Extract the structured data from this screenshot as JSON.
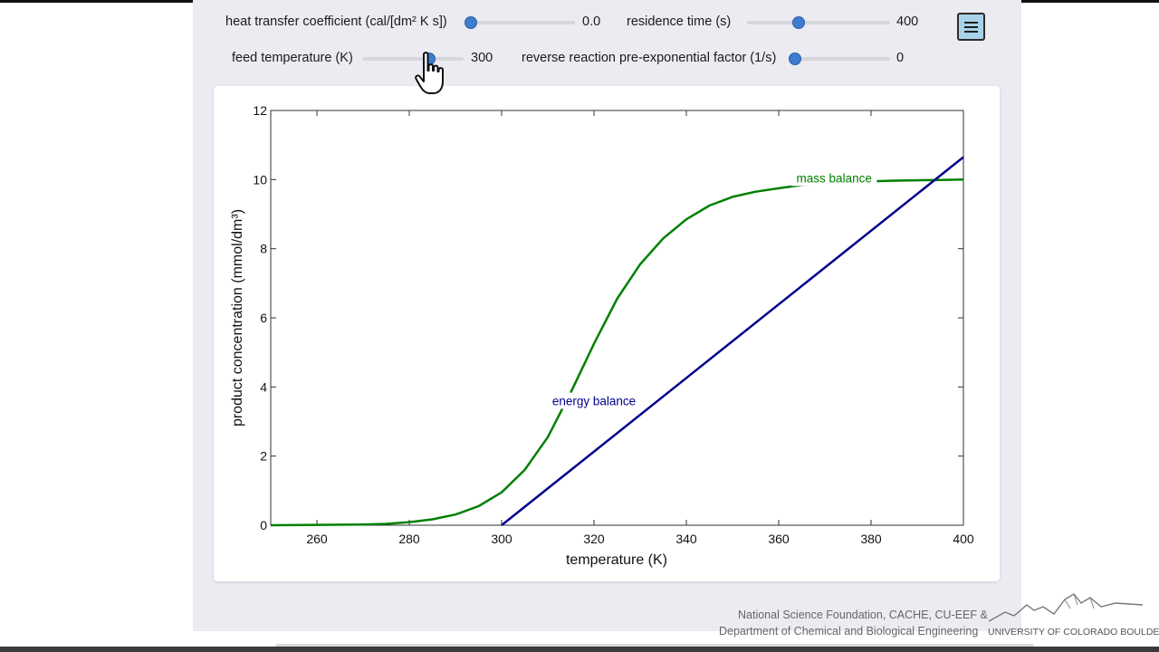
{
  "controls": {
    "heat_transfer": {
      "label": "heat transfer coefficient (cal/[dm² K s])",
      "value": "0.0",
      "fraction": 0.0
    },
    "residence_time": {
      "label": "residence time (s)",
      "value": "400",
      "fraction": 0.35
    },
    "feed_temperature": {
      "label": "feed temperature (K)",
      "value": "300",
      "fraction": 0.68
    },
    "reverse_factor": {
      "label": "reverse reaction pre-exponential factor (1/s)",
      "value": "0",
      "fraction": 0.0
    }
  },
  "menu": {
    "icon": "hamburger-menu-icon"
  },
  "colors": {
    "mass": "#008000",
    "energy": "#00008b",
    "accent": "#3e7ccf"
  },
  "chart_data": {
    "type": "line",
    "xlabel": "temperature (K)",
    "ylabel": "product concentration (mmol/dm³)",
    "xlim": [
      250,
      400
    ],
    "ylim": [
      0,
      12
    ],
    "xticks": [
      260,
      280,
      300,
      320,
      340,
      360,
      380,
      400
    ],
    "yticks": [
      0,
      2,
      4,
      6,
      8,
      10,
      12
    ],
    "series": [
      {
        "name": "mass balance",
        "color": "#008000",
        "x": [
          250,
          260,
          270,
          275,
          280,
          285,
          290,
          295,
          300,
          305,
          310,
          315,
          320,
          325,
          330,
          335,
          340,
          345,
          350,
          355,
          360,
          365,
          370,
          375,
          380,
          385,
          390,
          395,
          400
        ],
        "y": [
          0.0,
          0.01,
          0.02,
          0.04,
          0.09,
          0.17,
          0.31,
          0.55,
          0.95,
          1.6,
          2.55,
          3.85,
          5.25,
          6.55,
          7.55,
          8.3,
          8.85,
          9.25,
          9.5,
          9.65,
          9.75,
          9.84,
          9.9,
          9.93,
          9.95,
          9.97,
          9.98,
          9.99,
          10.0
        ]
      },
      {
        "name": "energy balance",
        "color": "#00008b",
        "x": [
          300,
          400
        ],
        "y": [
          0.0,
          10.65
        ]
      }
    ],
    "annotations": [
      {
        "text": "mass balance",
        "x": 372,
        "y": 10.0,
        "color": "#008000"
      },
      {
        "text": "energy balance",
        "x": 320,
        "y": 3.55,
        "color": "#00008b"
      }
    ]
  },
  "footer": {
    "line1": "National Science Foundation, CACHE, CU-EEF &",
    "line2": "Department of Chemical and Biological Engineering",
    "logo_text": "UNIVERSITY OF COLORADO BOULDER"
  }
}
